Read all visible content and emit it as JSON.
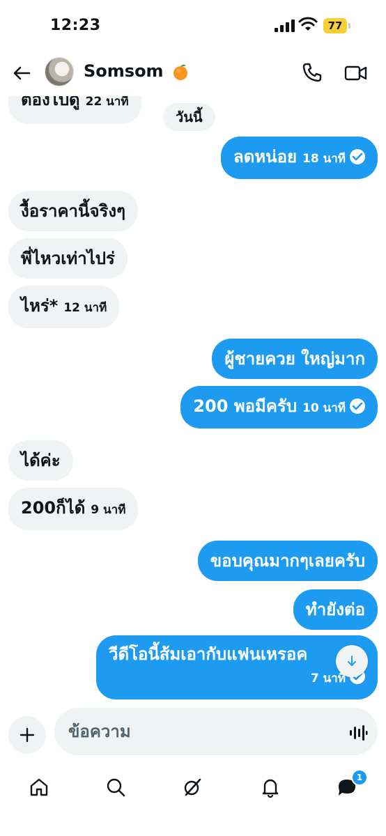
{
  "status_bar": {
    "time": "12:23",
    "battery": "77"
  },
  "header": {
    "contact_name": "Somsom",
    "icons": [
      "back-arrow-icon",
      "phone-icon",
      "video-icon"
    ]
  },
  "chat": {
    "date_divider": "วันนี้",
    "messages": [
      {
        "dir": "in",
        "text": "ต้องไปดู",
        "time": "22 นาที"
      },
      {
        "dir": "out",
        "text": "ลดหน่อย",
        "time": "18 นาที",
        "read": true
      },
      {
        "dir": "in",
        "text": "งื้อราคานี้จริงๆ"
      },
      {
        "dir": "in",
        "text": "พี่ไหวเท่าไปร่"
      },
      {
        "dir": "in",
        "text": "ไหร่*",
        "time": "12 นาที"
      },
      {
        "dir": "out",
        "text": "ผู้ชายควย ใหญ่มาก"
      },
      {
        "dir": "out",
        "text": "200 พอมีครับ",
        "time": "10 นาที",
        "read": true
      },
      {
        "dir": "in",
        "text": "ได้ค่ะ"
      },
      {
        "dir": "in",
        "text": "200ก็ได้",
        "time": "9 นาที"
      },
      {
        "dir": "out",
        "text": "ขอบคุณมากๆเลยครับ"
      },
      {
        "dir": "out",
        "text": "ทำยังต่อ"
      },
      {
        "dir": "out",
        "text": "วีดีโอนี้ส้มเอากับแฟนเหรอค",
        "time": "7 นาที",
        "read": true
      }
    ]
  },
  "composer": {
    "placeholder": "ข้อความ"
  },
  "nav": {
    "items": [
      "home-icon",
      "search-icon",
      "grok-icon",
      "notifications-icon",
      "messages-icon"
    ],
    "messages_badge": "1"
  },
  "colors": {
    "accent": "#1d9bf0",
    "incoming_bg": "#eff3f4",
    "battery": "#f7d033"
  }
}
